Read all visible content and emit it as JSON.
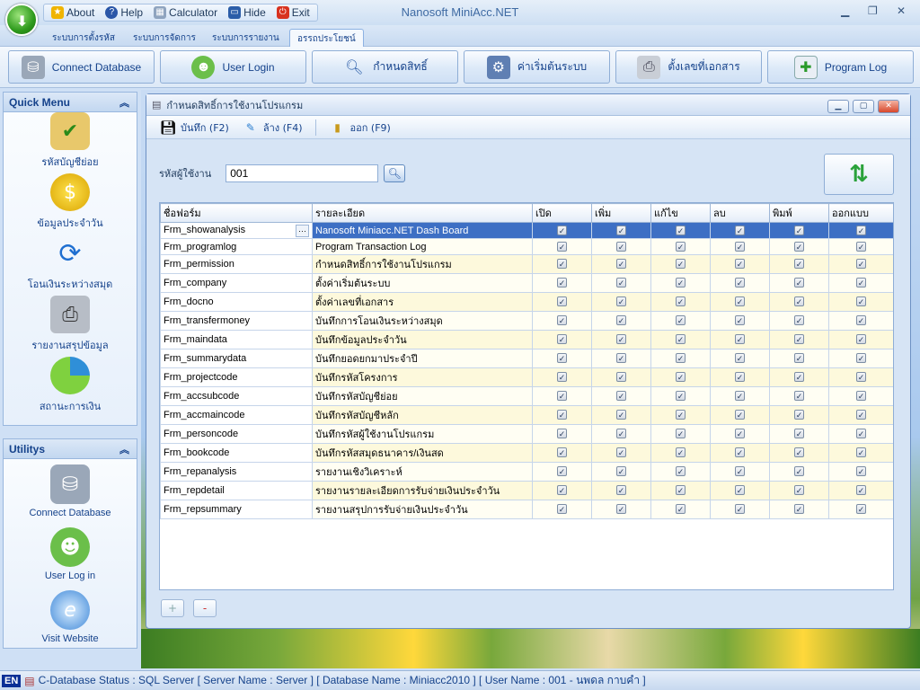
{
  "app": {
    "title": "Nanosoft MiniAcc.NET",
    "quick_access": [
      {
        "label": "About",
        "icon": "star-icon"
      },
      {
        "label": "Help",
        "icon": "help-icon"
      },
      {
        "label": "Calculator",
        "icon": "calculator-icon"
      },
      {
        "label": "Hide",
        "icon": "monitor-icon"
      },
      {
        "label": "Exit",
        "icon": "power-icon"
      }
    ]
  },
  "tabs": [
    {
      "label": "ระบบการตั้งรหัส"
    },
    {
      "label": "ระบบการจัดการ"
    },
    {
      "label": "ระบบการรายงาน"
    },
    {
      "label": "อรรถประโยชน์"
    }
  ],
  "ribbon": [
    {
      "label": "Connect Database",
      "icon": "database-icon"
    },
    {
      "label": "User Login",
      "icon": "user-icon"
    },
    {
      "label": "กำหนดสิทธิ์",
      "icon": "magnifier-icon"
    },
    {
      "label": "ค่าเริ่มต้นระบบ",
      "icon": "settings-icon"
    },
    {
      "label": "ตั้งเลขที่เอกสาร",
      "icon": "printer-icon"
    },
    {
      "label": "Program Log",
      "icon": "log-window-icon"
    }
  ],
  "quick_menu": {
    "title": "Quick Menu",
    "items": [
      {
        "label": "รหัสบัญชีย่อย",
        "icon": "notepad-check-icon"
      },
      {
        "label": "ข้อมูลประจำวัน",
        "icon": "dollar-coin-icon"
      },
      {
        "label": "โอนเงินระหว่างสมุด",
        "icon": "refresh-arrows-icon"
      },
      {
        "label": "รายงานสรุปข้อมูล",
        "icon": "printer-icon"
      },
      {
        "label": "สถานะการเงิน",
        "icon": "pie-chart-icon"
      }
    ]
  },
  "utilitys": {
    "title": "Utilitys",
    "items": [
      {
        "label": "Connect Database",
        "icon": "database-icon"
      },
      {
        "label": "User Log in",
        "icon": "user-clock-icon"
      },
      {
        "label": "Visit Website",
        "icon": "ie-globe-icon"
      }
    ]
  },
  "window": {
    "title": "กำหนดสิทธิ์การใช้งานโปรแกรม",
    "toolbar": {
      "save": "บันทึก (F2)",
      "clear": "ล้าง (F4)",
      "exit": "ออก (F9)"
    },
    "user_code_label": "รหัสผู้ใช้งาน",
    "user_code_value": "001"
  },
  "grid": {
    "columns": [
      "ชื่อฟอร์ม",
      "รายละเอียด",
      "เปิด",
      "เพิ่ม",
      "แก้ไข",
      "ลบ",
      "พิมพ์",
      "ออกแบบ"
    ],
    "rows": [
      {
        "form": "Frm_showanalysis",
        "desc": "Nanosoft Miniacc.NET Dash Board",
        "perm": [
          true,
          true,
          true,
          true,
          true,
          true
        ]
      },
      {
        "form": "Frm_programlog",
        "desc": "Program Transaction Log",
        "perm": [
          true,
          true,
          true,
          true,
          true,
          true
        ]
      },
      {
        "form": "Frm_permission",
        "desc": "กำหนดสิทธิ์การใช้งานโปรแกรม",
        "perm": [
          true,
          true,
          true,
          true,
          true,
          true
        ]
      },
      {
        "form": "Frm_company",
        "desc": "ตั้งค่าเริ่มต้นระบบ",
        "perm": [
          true,
          true,
          true,
          true,
          true,
          true
        ]
      },
      {
        "form": "Frm_docno",
        "desc": "ตั้งค่าเลขที่เอกสาร",
        "perm": [
          true,
          true,
          true,
          true,
          true,
          true
        ]
      },
      {
        "form": "Frm_transfermoney",
        "desc": "บันทึกการโอนเงินระหว่างสมุด",
        "perm": [
          true,
          true,
          true,
          true,
          true,
          true
        ]
      },
      {
        "form": "Frm_maindata",
        "desc": "บันทึกข้อมูลประจำวัน",
        "perm": [
          true,
          true,
          true,
          true,
          true,
          true
        ]
      },
      {
        "form": "Frm_summarydata",
        "desc": "บันทึกยอดยกมาประจำปี",
        "perm": [
          true,
          true,
          true,
          true,
          true,
          true
        ]
      },
      {
        "form": "Frm_projectcode",
        "desc": "บันทึกรหัสโครงการ",
        "perm": [
          true,
          true,
          true,
          true,
          true,
          true
        ]
      },
      {
        "form": "Frm_accsubcode",
        "desc": "บันทึกรหัสบัญชีย่อย",
        "perm": [
          true,
          true,
          true,
          true,
          true,
          true
        ]
      },
      {
        "form": "Frm_accmaincode",
        "desc": "บันทึกรหัสบัญชีหลัก",
        "perm": [
          true,
          true,
          true,
          true,
          true,
          true
        ]
      },
      {
        "form": "Frm_personcode",
        "desc": "บันทึกรหัสผู้ใช้งานโปรแกรม",
        "perm": [
          true,
          true,
          true,
          true,
          true,
          true
        ]
      },
      {
        "form": "Frm_bookcode",
        "desc": "บันทึกรหัสสมุดธนาคาร/เงินสด",
        "perm": [
          true,
          true,
          true,
          true,
          true,
          true
        ]
      },
      {
        "form": "Frm_repanalysis",
        "desc": "รายงานเชิงวิเคราะห์",
        "perm": [
          true,
          true,
          true,
          true,
          true,
          true
        ]
      },
      {
        "form": "Frm_repdetail",
        "desc": "รายงานรายละเอียดการรับจ่ายเงินประจำวัน",
        "perm": [
          true,
          true,
          true,
          true,
          true,
          true
        ]
      },
      {
        "form": "Frm_repsummary",
        "desc": "รายงานสรุปการรับจ่ายเงินประจำวัน",
        "perm": [
          true,
          true,
          true,
          true,
          true,
          true
        ]
      }
    ]
  },
  "status_bar": {
    "lang": "EN",
    "text": "C-Database Status : SQL Server [ Server Name : Server ]  [ Database Name : Miniacc2010 ]  [ User Name : 001 - นพดล กาบคำ ]"
  }
}
